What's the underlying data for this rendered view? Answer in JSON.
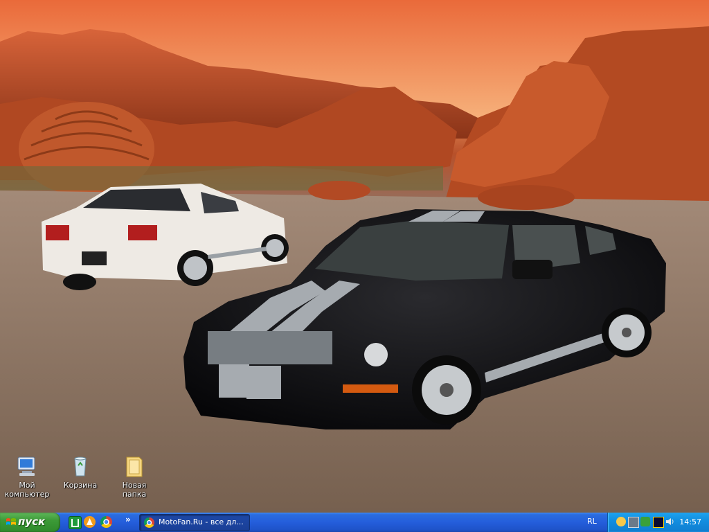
{
  "desktop": {
    "wallpaper_icon": "wallpaper-image",
    "icons": [
      {
        "label_line1": "Мой",
        "label_line2": "компьютер",
        "icon": "my-computer-icon"
      },
      {
        "label_line1": "Корзина",
        "icon": "recycle-bin-icon"
      },
      {
        "label_line1": "Новая папка",
        "icon": "folder-icon"
      }
    ]
  },
  "taskbar": {
    "start_label": "пуск",
    "quick_launch": [
      "show-desktop-icon",
      "avast-icon",
      "chrome-icon"
    ],
    "more_label": "»",
    "task_button": {
      "label": "MotoFan.Ru - все дл...",
      "icon": "chrome-icon"
    },
    "language": "RL",
    "tray_icons": [
      "messenger-icon",
      "network-icon",
      "antivirus-icon",
      "media-icon",
      "volume-icon"
    ],
    "clock": "14:57"
  },
  "colors": {
    "taskbar_blue": "#245edb",
    "start_green": "#3c9a37",
    "tray_blue": "#128fe0"
  }
}
